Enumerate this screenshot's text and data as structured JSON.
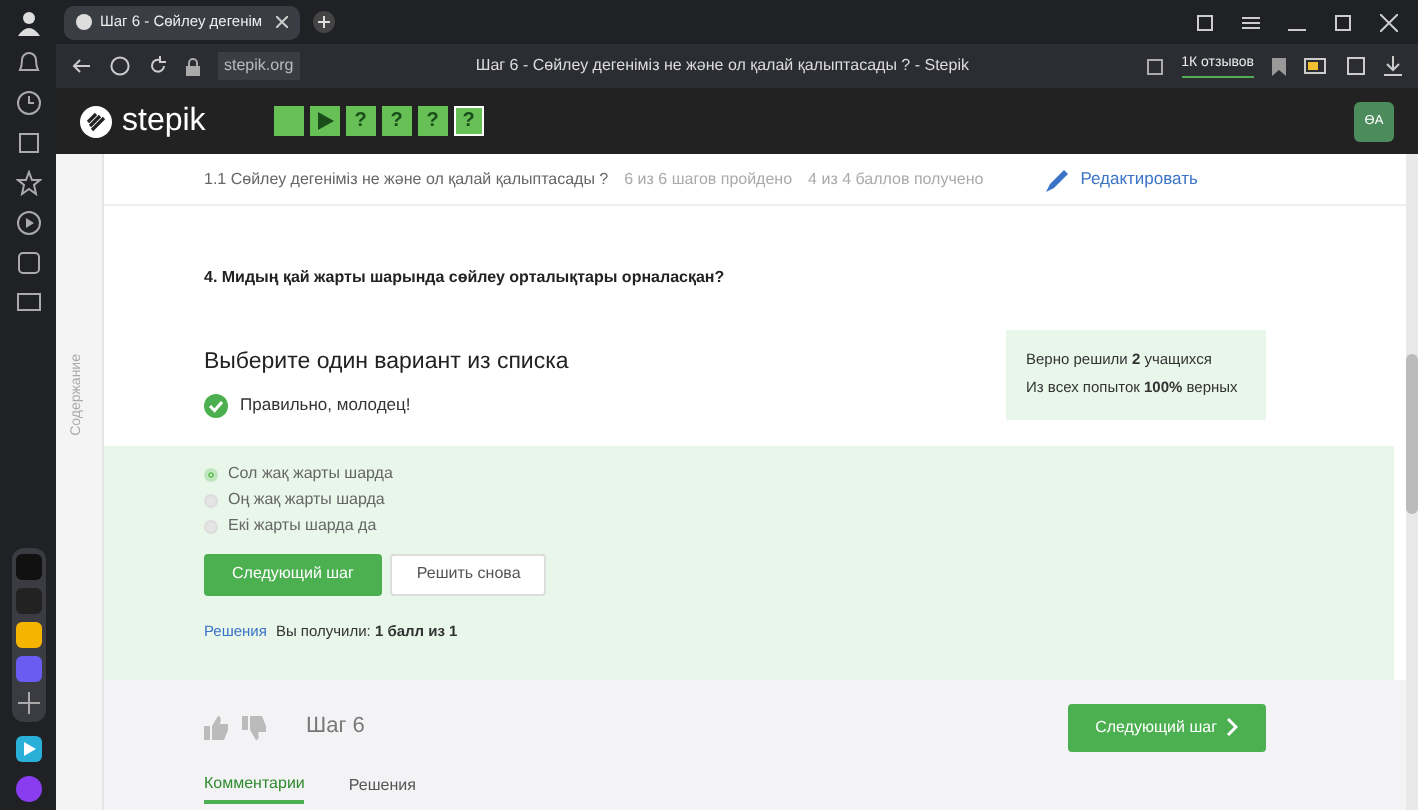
{
  "browser": {
    "tab_title": "Шаг 6 - Сөйлеу дегенім",
    "address": "stepik.org",
    "page_title": "Шаг 6 - Сөйлеу дегеніміз не және ол қалай қалыптасады ? - Stepik",
    "reviews": "1К отзывов"
  },
  "header": {
    "logo": "stepik",
    "avatar": "ӨА",
    "steps": [
      {
        "kind": "text",
        "selected": false
      },
      {
        "kind": "video",
        "selected": false
      },
      {
        "kind": "quiz",
        "label": "?",
        "selected": false
      },
      {
        "kind": "quiz",
        "label": "?",
        "selected": false
      },
      {
        "kind": "quiz",
        "label": "?",
        "selected": false
      },
      {
        "kind": "quiz",
        "label": "?",
        "selected": true
      }
    ]
  },
  "sidebar": {
    "label": "Содержание"
  },
  "breadcrumb": {
    "lesson": "1.1 Сөйлеу дегеніміз не және ол қалай қалыптасады ?",
    "steps_done": {
      "text": "6 из 6 шагов пройдено",
      "muted": true
    },
    "points": {
      "text": "4 из 4 баллов  получено",
      "muted": true
    },
    "edit": "Редактировать"
  },
  "question": "4. Мидың қай жарты шарында сөйлеу орталықтары орналасқан?",
  "quiz": {
    "title": "Выберите один вариант из списка",
    "feedback": "Правильно, молодец!",
    "stats": [
      "Верно решили **2** учащихся",
      "Из всех попыток **100%** верных"
    ],
    "options": [
      {
        "label": "Сол жақ жарты шарда",
        "selected": true
      },
      {
        "label": "Оң жақ жарты шарда",
        "selected": false
      },
      {
        "label": "Екі жарты шарда да",
        "selected": false
      }
    ],
    "next_button": "Следующий шаг",
    "retry_button": "Решить снова",
    "solutions_link": "Решения",
    "score": "Вы получили: **1 балл из 1**"
  },
  "footer": {
    "step_title": "Шаг 6",
    "next_button": "Следующий шаг",
    "tabs": [
      {
        "label": "Комментарии",
        "selected": true
      },
      {
        "label": "Решения",
        "selected": false
      }
    ]
  }
}
